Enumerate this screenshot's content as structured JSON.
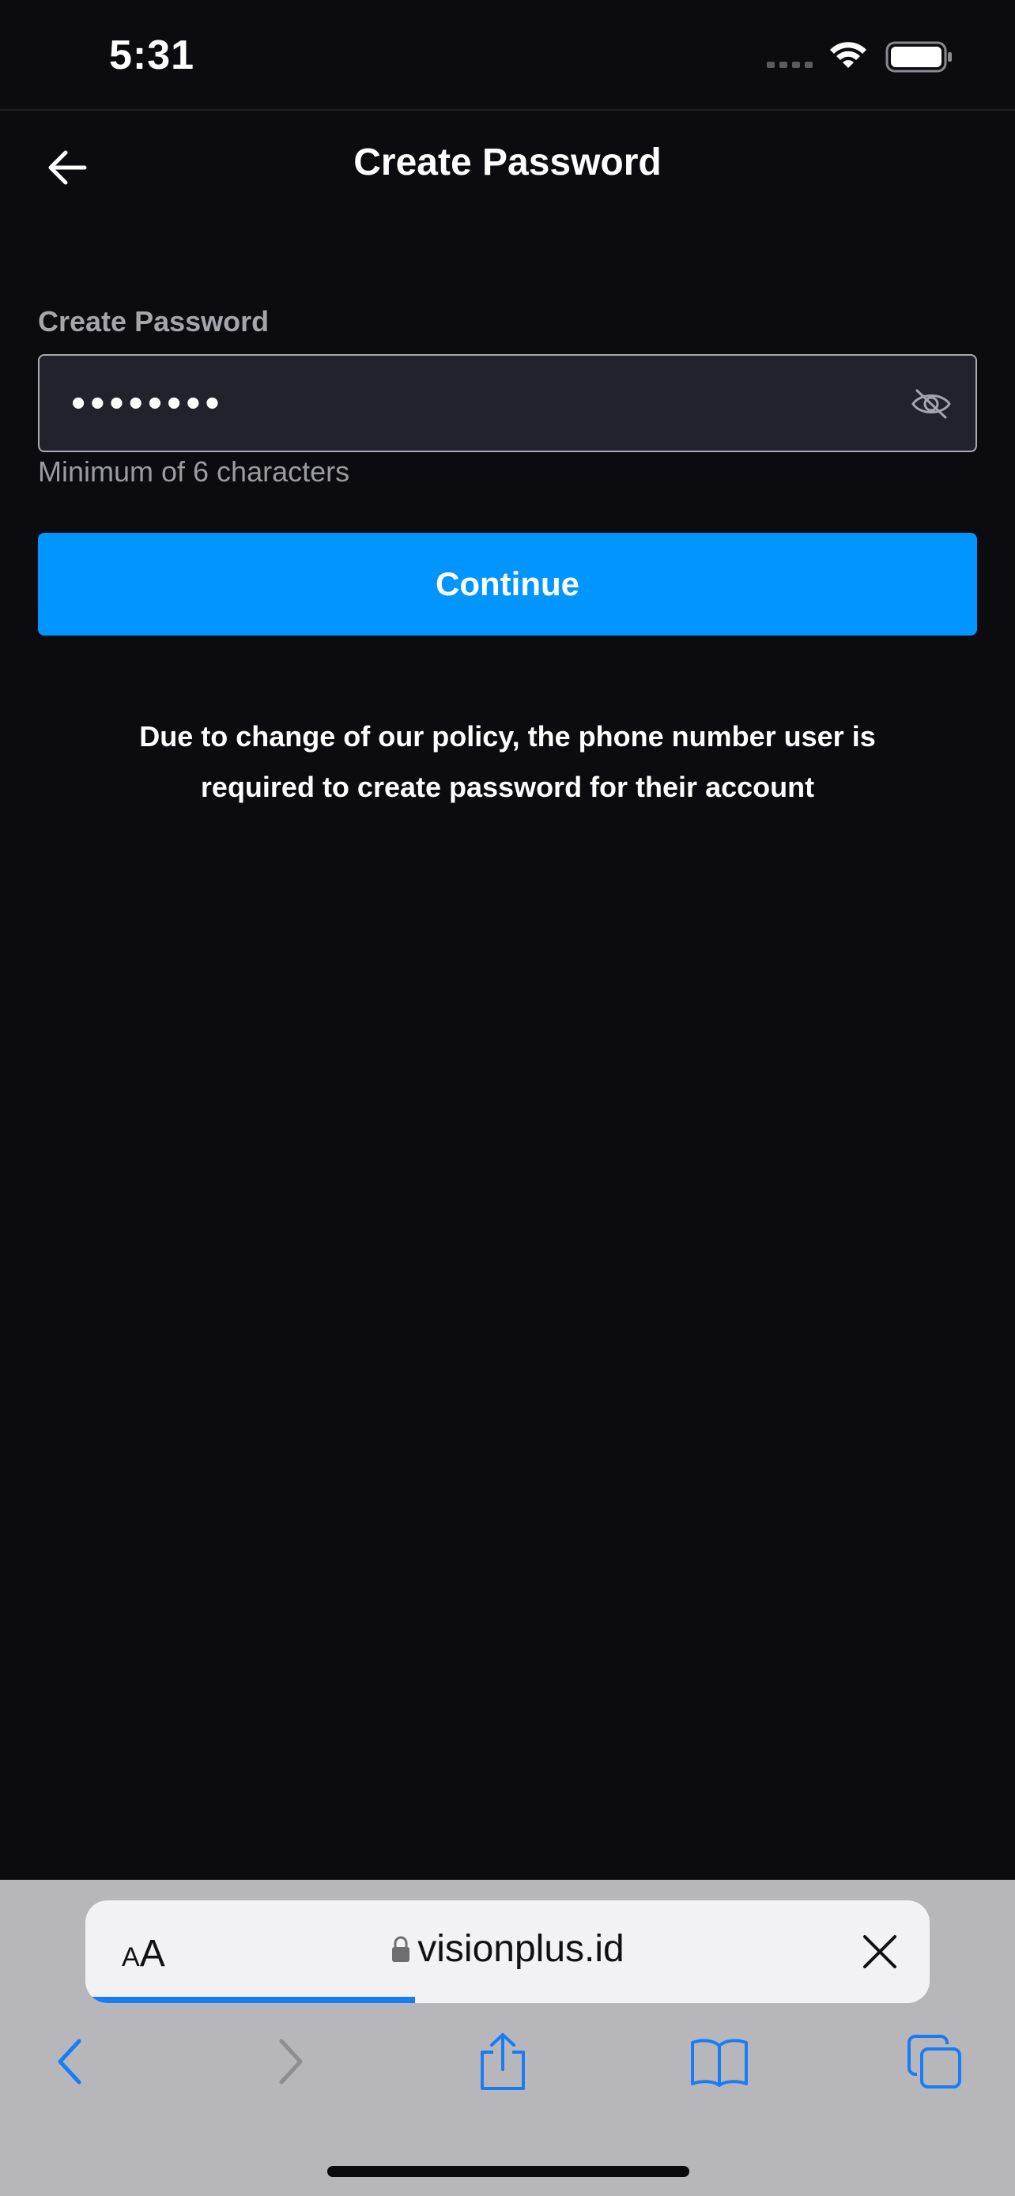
{
  "status_bar": {
    "time": "5:31"
  },
  "header": {
    "title": "Create Password",
    "back_icon": "arrow-left-icon"
  },
  "form": {
    "label": "Create Password",
    "password_value": "••••••••",
    "hint": "Minimum of 6 characters",
    "eye_icon": "eye-off-icon"
  },
  "continue_button": {
    "label": "Continue",
    "color": "#0095ff"
  },
  "notice": {
    "text": "Due to change of our policy, the phone number user is required to create password for their account"
  },
  "safari": {
    "aa_label": "AA",
    "url": "visionplus.id",
    "load_progress": 0.39,
    "accent": "#1a7cf5"
  }
}
